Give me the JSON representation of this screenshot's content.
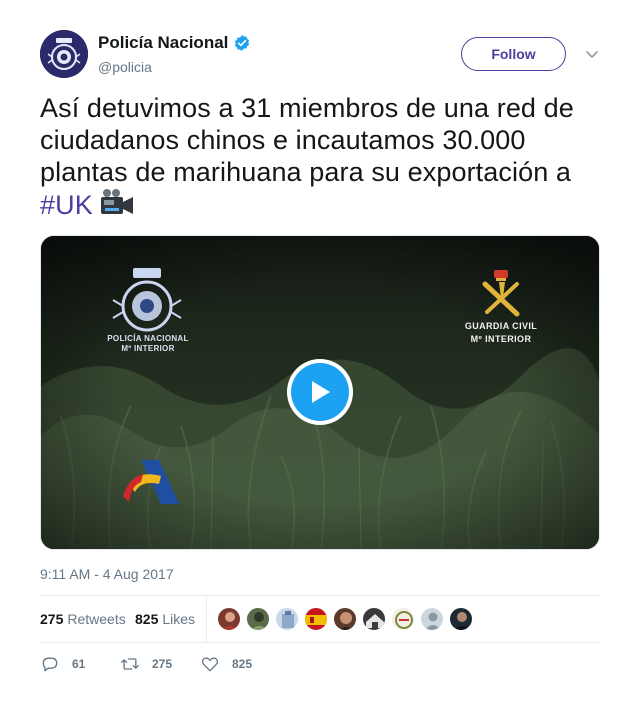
{
  "account": {
    "display_name": "Policía Nacional",
    "handle": "@policia",
    "verified": true,
    "avatar_icon": "policia-nacional-crest-icon"
  },
  "follow_label": "Follow",
  "tweet": {
    "text": "Así detuvimos a 31 miembros de una red de ciudadanos chinos e incautamos 30.000 plantas de marihuana para su exportación a ",
    "hashtag": "#UK",
    "emoji": "video-camera-emoji"
  },
  "media": {
    "type": "video",
    "logos": {
      "left_top_caption_line1": "POLICÍA NACIONAL",
      "left_top_caption_line2": "Mº INTERIOR",
      "right_top_caption_line1": "GUARDIA CIVIL",
      "right_top_caption_line2": "Mº INTERIOR"
    },
    "play_icon": "play-icon"
  },
  "timestamp": "9:11 AM - 4 Aug 2017",
  "stats": {
    "retweets_count": "275",
    "retweets_label": "Retweets",
    "likes_count": "825",
    "likes_label": "Likes"
  },
  "actions": {
    "reply_count": "61",
    "retweet_count": "275",
    "like_count": "825"
  },
  "colors": {
    "accent": "#4a3f9e",
    "verified": "#1da1f2",
    "muted_text": "#657786"
  }
}
